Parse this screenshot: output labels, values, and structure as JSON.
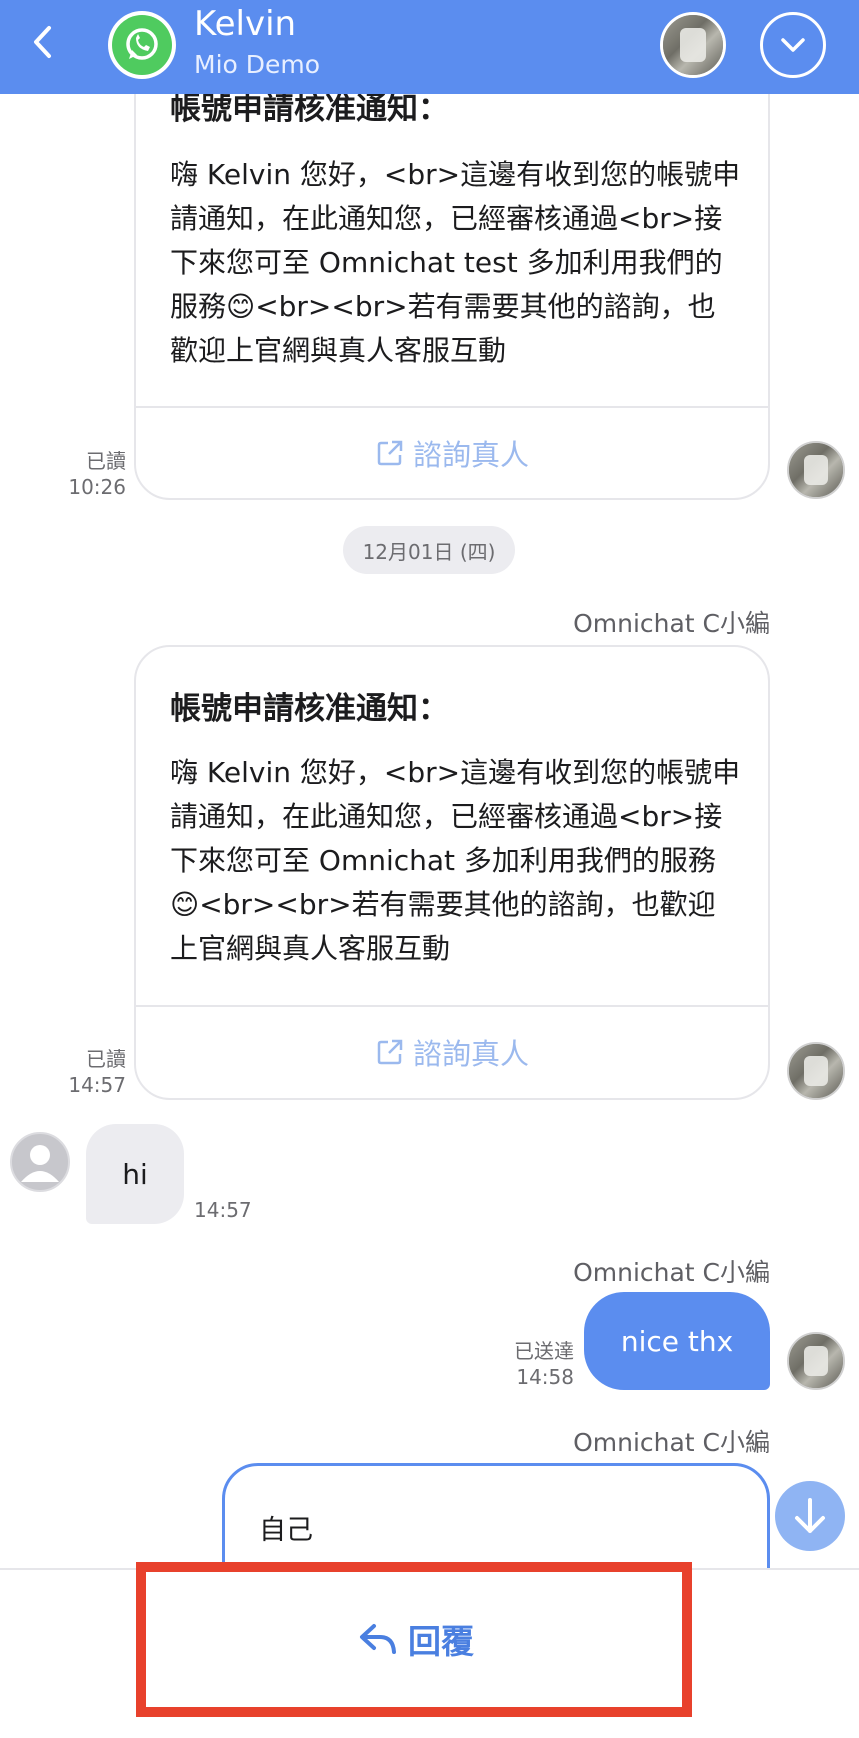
{
  "header": {
    "title": "Kelvin",
    "subtitle": "Mio Demo"
  },
  "card1": {
    "title": "帳號申請核准通知：",
    "body": "嗨 Kelvin 您好，<br>這邊有收到您的帳號申請通知，在此通知您，已經審核通過<br>接下來您可至 Omnichat test 多加利用我們的服務😊<br><br>若有需要其他的諮詢，也歡迎上官網與真人客服互動",
    "button": "諮詢真人",
    "status": "已讀",
    "time": "10:26"
  },
  "date_divider": "12月01日 (四)",
  "card2": {
    "sender": "Omnichat C小編",
    "title": "帳號申請核准通知：",
    "body": "嗨 Kelvin 您好，<br>這邊有收到您的帳號申請通知，在此通知您，已經審核通過<br>接下來您可至 Omnichat 多加利用我們的服務😊<br><br>若有需要其他的諮詢，也歡迎上官網與真人客服互動",
    "button": "諮詢真人",
    "status": "已讀",
    "time": "14:57"
  },
  "incoming": {
    "text": "hi",
    "time": "14:57"
  },
  "outgoing": {
    "sender": "Omnichat C小編",
    "text": "nice thx",
    "status": "已送達",
    "time": "14:58"
  },
  "partial": {
    "sender": "Omnichat C小編",
    "text": "自己"
  },
  "reply_label": "回覆",
  "colors": {
    "header": "#5b8def",
    "highlight": "#e8412c",
    "whatsapp": "#4fcb5f"
  }
}
